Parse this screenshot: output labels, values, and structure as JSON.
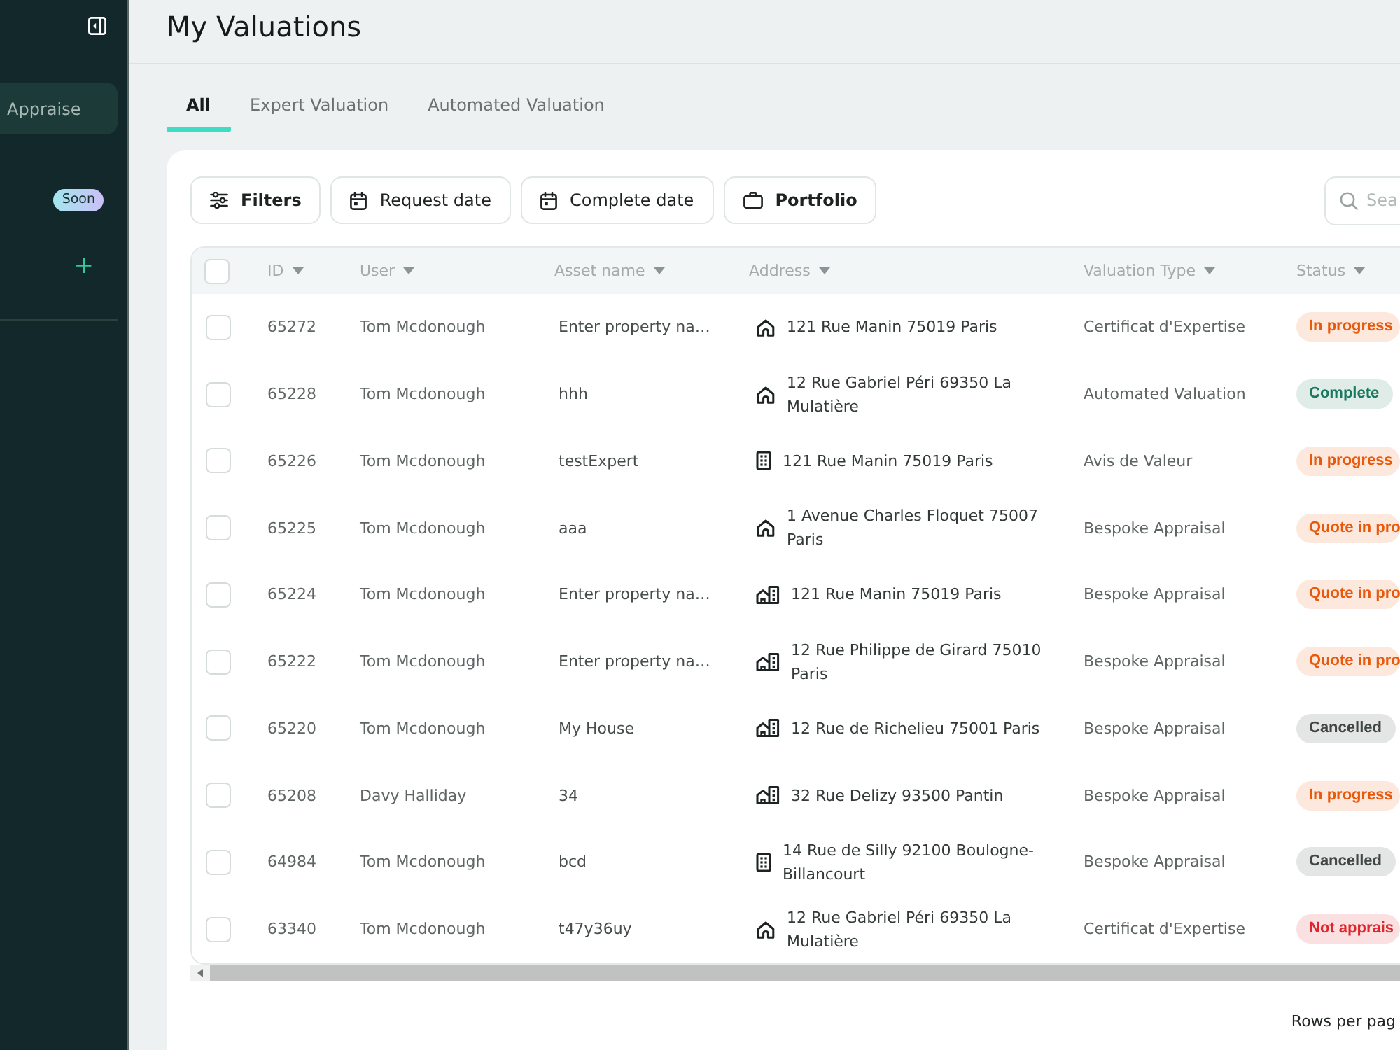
{
  "page": {
    "title": "My Valuations"
  },
  "sidebar": {
    "items": [
      {
        "label": "Appraise",
        "selected": true
      }
    ],
    "soon_badge": "Soon",
    "add_button": "+"
  },
  "tabs": [
    {
      "label": "All",
      "selected": true
    },
    {
      "label": "Expert Valuation",
      "selected": false
    },
    {
      "label": "Automated Valuation",
      "selected": false
    }
  ],
  "toolbar": {
    "buttons": [
      {
        "kind": "filters",
        "label": "Filters"
      },
      {
        "kind": "date",
        "label": "Request date"
      },
      {
        "kind": "date",
        "label": "Complete date"
      },
      {
        "kind": "portfolio",
        "label": "Portfolio"
      }
    ],
    "search": {
      "placeholder": "Sea"
    }
  },
  "table": {
    "select_all": {
      "checked": false
    },
    "columns": [
      "ID",
      "User",
      "Asset name",
      "Address",
      "Valuation Type",
      "Status"
    ],
    "rows": [
      {
        "checked": false,
        "id": "65272",
        "user": "Tom Mcdonough",
        "asset": "Enter property na…",
        "kind": "house",
        "address": "121 Rue Manin 75019 Paris",
        "valuation_type": "Certificat d'Expertise",
        "status": {
          "label": "In progress",
          "color": "#e8590c"
        }
      },
      {
        "checked": false,
        "id": "65228",
        "user": "Tom Mcdonough",
        "asset": "hhh",
        "kind": "house",
        "address": "12 Rue Gabriel Péri 69350 La Mulatière",
        "valuation_type": "Automated Valuation",
        "status": {
          "label": "Complete",
          "color": "#19795f"
        }
      },
      {
        "checked": false,
        "id": "65226",
        "user": "Tom Mcdonough",
        "asset": "testExpert",
        "kind": "building",
        "address": "121 Rue Manin 75019 Paris",
        "valuation_type": "Avis de Valeur",
        "status": {
          "label": "In progress",
          "color": "#e8590c"
        }
      },
      {
        "checked": false,
        "id": "65225",
        "user": "Tom Mcdonough",
        "asset": "aaa",
        "kind": "house",
        "address": "1 Avenue Charles Floquet 75007 Paris",
        "valuation_type": "Bespoke Appraisal",
        "status": {
          "label": "Quote in pro",
          "color": "#e8590c"
        }
      },
      {
        "checked": false,
        "id": "65224",
        "user": "Tom Mcdonough",
        "asset": "Enter property na…",
        "kind": "house-and-building",
        "address": "121 Rue Manin 75019 Paris",
        "valuation_type": "Bespoke Appraisal",
        "status": {
          "label": "Quote in pro",
          "color": "#e8590c"
        }
      },
      {
        "checked": false,
        "id": "65222",
        "user": "Tom Mcdonough",
        "asset": "Enter property na…",
        "kind": "house-and-building",
        "address": "12 Rue Philippe de Girard 75010 Paris",
        "valuation_type": "Bespoke Appraisal",
        "status": {
          "label": "Quote in pro",
          "color": "#e8590c"
        }
      },
      {
        "checked": false,
        "id": "65220",
        "user": "Tom Mcdonough",
        "asset": "My House",
        "kind": "house-and-building",
        "address": "12 Rue de Richelieu 75001 Paris",
        "valuation_type": "Bespoke Appraisal",
        "status": {
          "label": "Cancelled",
          "color": "#3f4644"
        }
      },
      {
        "checked": false,
        "id": "65208",
        "user": "Davy Halliday",
        "asset": "34",
        "kind": "house-and-building",
        "address": "32 Rue Delizy 93500 Pantin",
        "valuation_type": "Bespoke Appraisal",
        "status": {
          "label": "In progress",
          "color": "#e8590c"
        }
      },
      {
        "checked": false,
        "id": "64984",
        "user": "Tom Mcdonough",
        "asset": "bcd",
        "kind": "building",
        "address": "14 Rue de Silly 92100 Boulogne-Billancourt",
        "valuation_type": "Bespoke Appraisal",
        "status": {
          "label": "Cancelled",
          "color": "#3f4644"
        }
      },
      {
        "checked": false,
        "id": "63340",
        "user": "Tom Mcdonough",
        "asset": "t47y36uy",
        "kind": "house",
        "address": "12 Rue Gabriel Péri 69350 La Mulatière",
        "valuation_type": "Certificat d'Expertise",
        "status": {
          "label": "Not apprais",
          "color": "#e0262c"
        }
      }
    ]
  },
  "pagination": {
    "rows_per_page_label": "Rows per pag"
  }
}
